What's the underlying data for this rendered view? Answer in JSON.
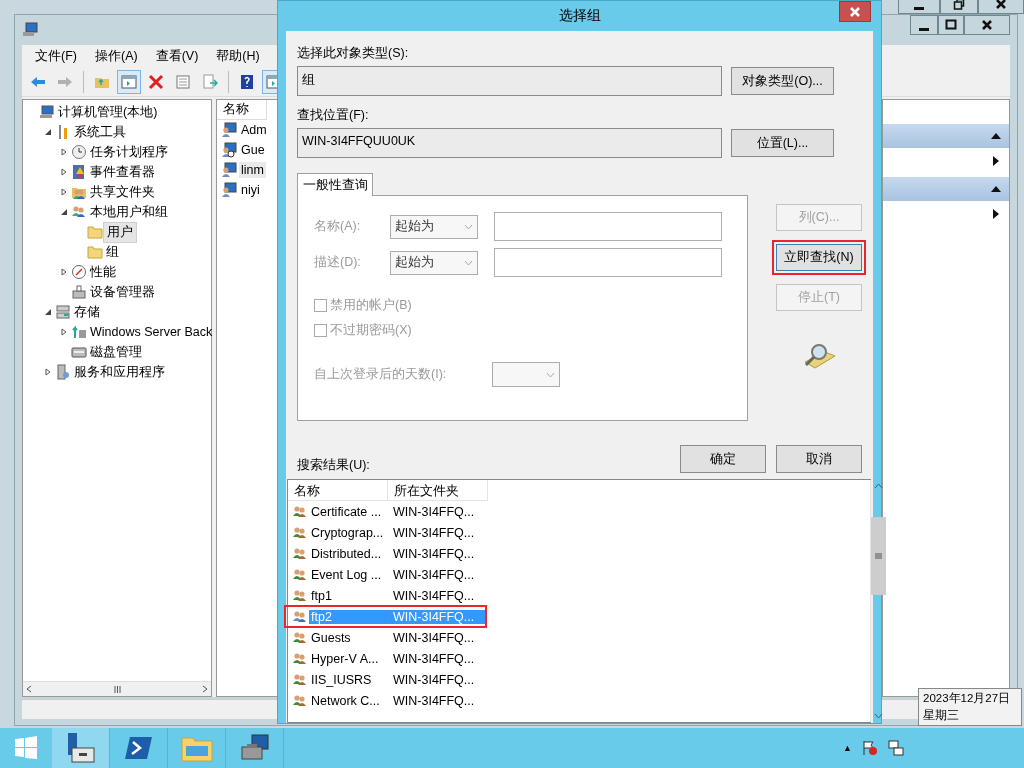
{
  "menu": [
    "文件(F)",
    "操作(A)",
    "查看(V)",
    "帮助(H)"
  ],
  "toolbar": [
    {
      "kind": "back",
      "disabled": false
    },
    {
      "kind": "forward",
      "disabled": true
    },
    {
      "kind": "up",
      "disabled": false
    },
    {
      "kind": "pane",
      "disabled": false
    },
    {
      "kind": "delete",
      "disabled": false
    },
    {
      "kind": "properties",
      "disabled": false
    },
    {
      "kind": "export",
      "disabled": false
    },
    {
      "kind": "help",
      "disabled": false
    },
    {
      "kind": "pane",
      "disabled": false
    }
  ],
  "tree": [
    {
      "label": "计算机管理(本地)",
      "kind": "computer",
      "selected": false,
      "children": [
        {
          "label": "系统工具",
          "kind": "tools",
          "selected": false,
          "expanded": true,
          "children": [
            {
              "label": "任务计划程序",
              "kind": "clock",
              "selected": false,
              "expanded": false
            },
            {
              "label": "事件查看器",
              "kind": "event",
              "selected": false,
              "expanded": false
            },
            {
              "label": "共享文件夹",
              "kind": "share",
              "selected": false,
              "expanded": false
            },
            {
              "label": "本地用户和组",
              "kind": "users",
              "selected": false,
              "expanded": true,
              "children": [
                {
                  "label": "用户",
                  "kind": "folder",
                  "selected": true
                },
                {
                  "label": "组",
                  "kind": "folder",
                  "selected": false
                }
              ]
            },
            {
              "label": "性能",
              "kind": "performance",
              "selected": false,
              "expanded": false
            },
            {
              "label": "设备管理器",
              "kind": "device",
              "selected": false
            }
          ]
        },
        {
          "label": "存储",
          "kind": "storage",
          "selected": false,
          "expanded": true,
          "children": [
            {
              "label": "Windows Server Back",
              "kind": "backup",
              "selected": false,
              "expanded": false
            },
            {
              "label": "磁盘管理",
              "kind": "disk",
              "selected": false
            }
          ]
        },
        {
          "label": "服务和应用程序",
          "kind": "services",
          "selected": false,
          "expanded": false
        }
      ]
    }
  ],
  "list": {
    "column": "名称",
    "items": [
      {
        "name": "Adm",
        "kind": "user",
        "selected": false
      },
      {
        "name": "Gue",
        "kind": "user-disabled",
        "selected": false
      },
      {
        "name": "linm",
        "kind": "user",
        "selected": true
      },
      {
        "name": "niyi",
        "kind": "user",
        "selected": false
      }
    ]
  },
  "dialog": {
    "title": "选择组",
    "object_type": {
      "label": "选择此对象类型(S):",
      "value": "组",
      "button": "对象类型(O)..."
    },
    "location": {
      "label": "查找位置(F):",
      "value": "WIN-3I4FFQUU0UK",
      "button": "位置(L)..."
    },
    "tab": {
      "label": "一般性查询",
      "selected": true
    },
    "query": {
      "disabled": true,
      "rows": [
        {
          "label": "名称(A):",
          "operator": "起始为"
        },
        {
          "label": "描述(D):",
          "operator": "起始为"
        }
      ],
      "checkboxes": [
        {
          "label": "禁用的帐户(B)",
          "checked": false
        },
        {
          "label": "不过期密码(X)",
          "checked": false
        }
      ],
      "days_label": "自上次登录后的天数(I):"
    },
    "side_buttons": [
      {
        "label": "列(C)...",
        "disabled": true,
        "highlighted": false
      },
      {
        "label": "立即查找(N)",
        "disabled": false,
        "highlighted": true
      },
      {
        "label": "停止(T)",
        "disabled": true,
        "highlighted": false
      }
    ],
    "ok": "确定",
    "cancel": "取消",
    "results_label": "搜索结果(U):",
    "results": {
      "columns": [
        "名称",
        "所在文件夹"
      ],
      "rows": [
        {
          "name": "Certificate ...",
          "folder": "WIN-3I4FFQ...",
          "selected": false,
          "highlighted": false
        },
        {
          "name": "Cryptograp...",
          "folder": "WIN-3I4FFQ...",
          "selected": false,
          "highlighted": false
        },
        {
          "name": "Distributed...",
          "folder": "WIN-3I4FFQ...",
          "selected": false,
          "highlighted": false
        },
        {
          "name": "Event Log ...",
          "folder": "WIN-3I4FFQ...",
          "selected": false,
          "highlighted": false
        },
        {
          "name": "ftp1",
          "folder": "WIN-3I4FFQ...",
          "selected": false,
          "highlighted": false
        },
        {
          "name": "ftp2",
          "folder": "WIN-3I4FFQ...",
          "selected": true,
          "highlighted": true
        },
        {
          "name": "Guests",
          "folder": "WIN-3I4FFQ...",
          "selected": false,
          "highlighted": false
        },
        {
          "name": "Hyper-V A...",
          "folder": "WIN-3I4FFQ...",
          "selected": false,
          "highlighted": false
        },
        {
          "name": "IIS_IUSRS",
          "folder": "WIN-3I4FFQ...",
          "selected": false,
          "highlighted": false
        },
        {
          "name": "Network C...",
          "folder": "WIN-3I4FFQ...",
          "selected": false,
          "highlighted": false
        }
      ]
    }
  },
  "taskbar": {
    "apps": [
      {
        "kind": "server-manager",
        "selected": true
      },
      {
        "kind": "powershell",
        "selected": false
      },
      {
        "kind": "explorer",
        "selected": false
      },
      {
        "kind": "computer-management",
        "selected": false
      }
    ],
    "tray_arrow": "▲"
  },
  "clock": {
    "date": "2023年12月27日",
    "weekday": "星期三"
  }
}
